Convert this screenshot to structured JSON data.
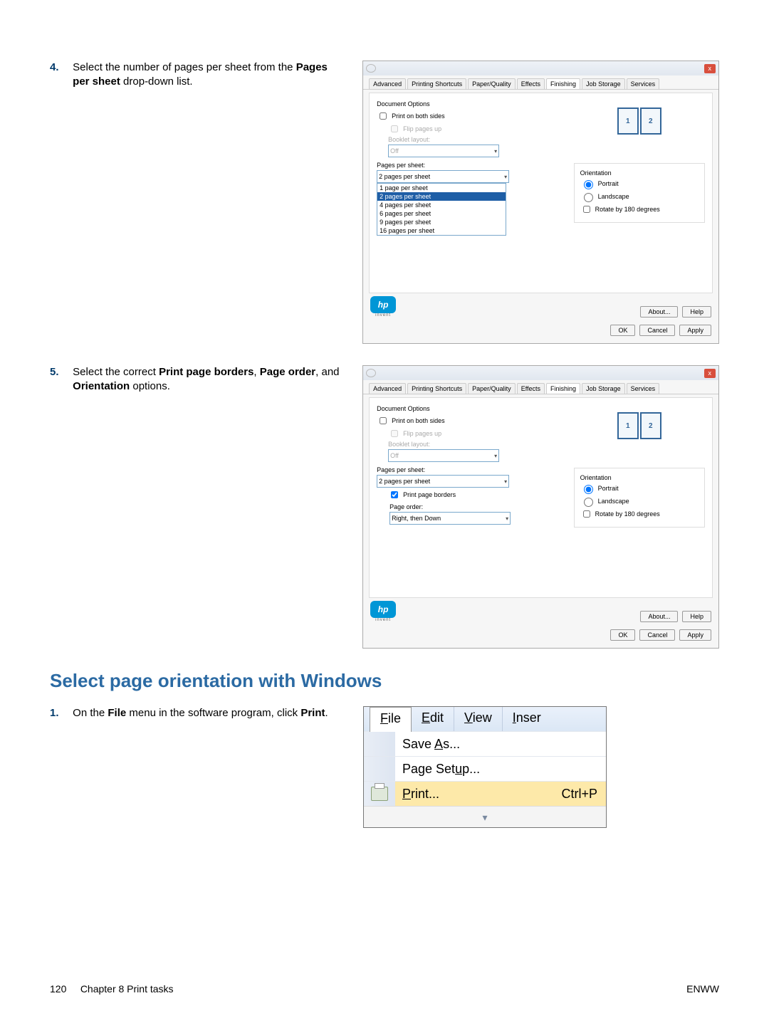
{
  "step4": {
    "num": "4.",
    "text_a": "Select the number of pages per sheet from the ",
    "bold": "Pages per sheet",
    "text_b": " drop-down list."
  },
  "step5": {
    "num": "5.",
    "text_a": "Select the correct ",
    "bold_a": "Print page borders",
    "text_b": ", ",
    "bold_b": "Page order",
    "text_c": ", and ",
    "bold_c": "Orientation",
    "text_d": " options."
  },
  "heading": "Select page orientation with Windows",
  "step1": {
    "num": "1.",
    "text_a": "On the ",
    "bold_a": "File",
    "text_b": " menu in the software program, click ",
    "bold_b": "Print",
    "text_c": "."
  },
  "dialog": {
    "close": "x",
    "tabs": [
      "Advanced",
      "Printing Shortcuts",
      "Paper/Quality",
      "Effects",
      "Finishing",
      "Job Storage",
      "Services"
    ],
    "active_tab": "Finishing",
    "doc_options": "Document Options",
    "print_both": "Print on both sides",
    "flip": "Flip pages up",
    "booklet": "Booklet layout:",
    "off": "Off",
    "pps_label": "Pages per sheet:",
    "pps_value": "2 pages per sheet",
    "pps_options": [
      "1 page per sheet",
      "2 pages per sheet",
      "4 pages per sheet",
      "6 pages per sheet",
      "9 pages per sheet",
      "16 pages per sheet"
    ],
    "borders": "Print page borders",
    "page_order": "Page order:",
    "order_value": "Right, then Down",
    "orientation": "Orientation",
    "portrait": "Portrait",
    "landscape": "Landscape",
    "rotate": "Rotate by 180 degrees",
    "about": "About...",
    "help": "Help",
    "ok": "OK",
    "cancel": "Cancel",
    "apply": "Apply",
    "hp": "hp",
    "invent": "invent",
    "preview1": "1",
    "preview2": "2"
  },
  "filemenu": {
    "file": "File",
    "edit": "Edit",
    "view": "View",
    "insert": "Inser",
    "saveas": "Save As...",
    "pagesetup": "Page Setup...",
    "print": "Print...",
    "accel": "Ctrl+P"
  },
  "footer": {
    "left_num": "120",
    "left_chap": "Chapter 8   Print tasks",
    "right": "ENWW"
  }
}
